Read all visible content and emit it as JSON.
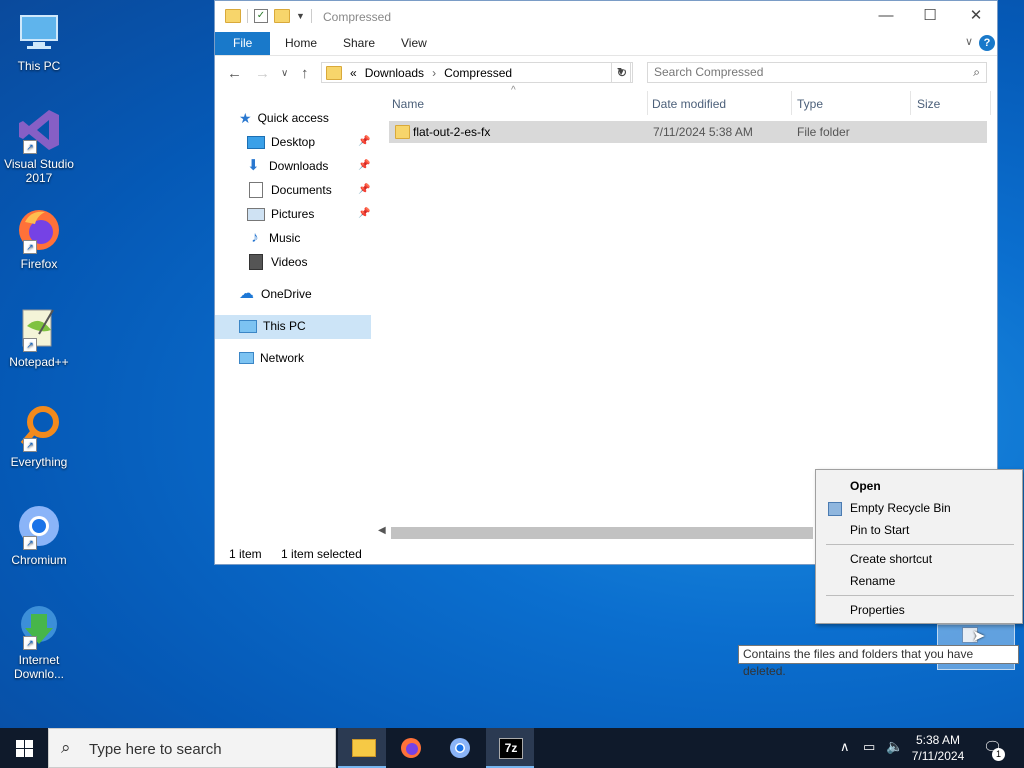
{
  "desktop": {
    "icons": [
      {
        "label": "This PC"
      },
      {
        "label": "Visual Studio 2017"
      },
      {
        "label": "Firefox"
      },
      {
        "label": "Notepad++"
      },
      {
        "label": "Everything"
      },
      {
        "label": "Chromium"
      },
      {
        "label": "Internet Downlo..."
      }
    ]
  },
  "explorer": {
    "title": "Compressed",
    "ribbon_tabs": [
      "File",
      "Home",
      "Share",
      "View"
    ],
    "address": {
      "prefix": "«",
      "crumbs": [
        "Downloads",
        "Compressed"
      ]
    },
    "search_placeholder": "Search Compressed",
    "nav": {
      "quick_access": "Quick access",
      "items": [
        "Desktop",
        "Downloads",
        "Documents",
        "Pictures",
        "Music",
        "Videos"
      ],
      "onedrive": "OneDrive",
      "this_pc": "This PC",
      "network": "Network"
    },
    "columns": [
      "Name",
      "Date modified",
      "Type",
      "Size"
    ],
    "rows": [
      {
        "name": "flat-out-2-es-fx",
        "date": "7/11/2024 5:38 AM",
        "type": "File folder",
        "size": ""
      }
    ],
    "status": {
      "count": "1 item",
      "selected": "1 item selected"
    }
  },
  "context_menu": {
    "items": [
      "Open",
      "Empty Recycle Bin",
      "Pin to Start",
      "Create shortcut",
      "Rename",
      "Properties"
    ]
  },
  "tooltip": "Contains the files and folders that you have deleted.",
  "taskbar": {
    "search_placeholder": "Type here to search",
    "time": "5:38 AM",
    "date": "7/11/2024",
    "notification_count": "1",
    "app_7z": "7z"
  }
}
